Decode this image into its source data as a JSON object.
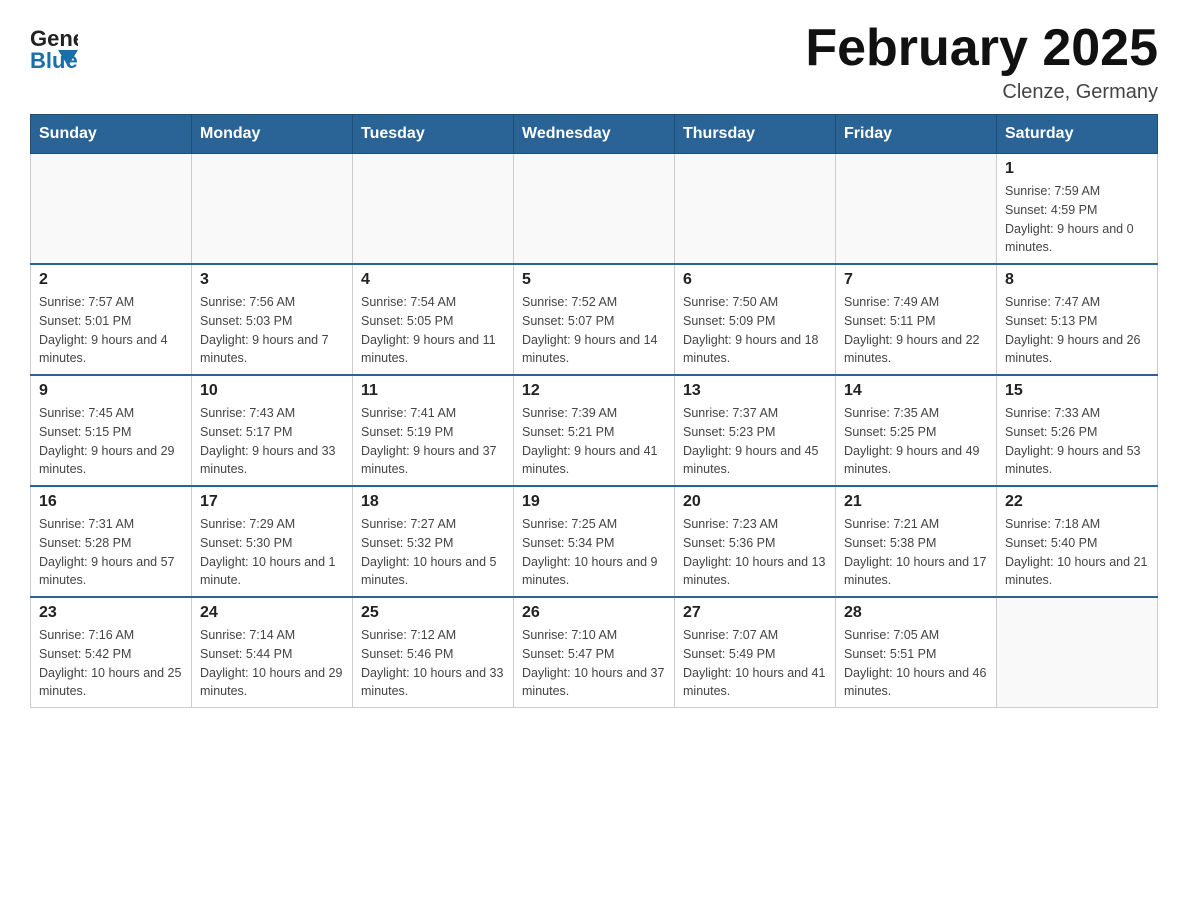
{
  "header": {
    "logo": {
      "text_general": "General",
      "text_blue": "Blue",
      "aria": "GeneralBlue logo"
    },
    "title": "February 2025",
    "subtitle": "Clenze, Germany"
  },
  "weekdays": [
    "Sunday",
    "Monday",
    "Tuesday",
    "Wednesday",
    "Thursday",
    "Friday",
    "Saturday"
  ],
  "weeks": [
    [
      {
        "day": "",
        "info": ""
      },
      {
        "day": "",
        "info": ""
      },
      {
        "day": "",
        "info": ""
      },
      {
        "day": "",
        "info": ""
      },
      {
        "day": "",
        "info": ""
      },
      {
        "day": "",
        "info": ""
      },
      {
        "day": "1",
        "info": "Sunrise: 7:59 AM\nSunset: 4:59 PM\nDaylight: 9 hours and 0 minutes."
      }
    ],
    [
      {
        "day": "2",
        "info": "Sunrise: 7:57 AM\nSunset: 5:01 PM\nDaylight: 9 hours and 4 minutes."
      },
      {
        "day": "3",
        "info": "Sunrise: 7:56 AM\nSunset: 5:03 PM\nDaylight: 9 hours and 7 minutes."
      },
      {
        "day": "4",
        "info": "Sunrise: 7:54 AM\nSunset: 5:05 PM\nDaylight: 9 hours and 11 minutes."
      },
      {
        "day": "5",
        "info": "Sunrise: 7:52 AM\nSunset: 5:07 PM\nDaylight: 9 hours and 14 minutes."
      },
      {
        "day": "6",
        "info": "Sunrise: 7:50 AM\nSunset: 5:09 PM\nDaylight: 9 hours and 18 minutes."
      },
      {
        "day": "7",
        "info": "Sunrise: 7:49 AM\nSunset: 5:11 PM\nDaylight: 9 hours and 22 minutes."
      },
      {
        "day": "8",
        "info": "Sunrise: 7:47 AM\nSunset: 5:13 PM\nDaylight: 9 hours and 26 minutes."
      }
    ],
    [
      {
        "day": "9",
        "info": "Sunrise: 7:45 AM\nSunset: 5:15 PM\nDaylight: 9 hours and 29 minutes."
      },
      {
        "day": "10",
        "info": "Sunrise: 7:43 AM\nSunset: 5:17 PM\nDaylight: 9 hours and 33 minutes."
      },
      {
        "day": "11",
        "info": "Sunrise: 7:41 AM\nSunset: 5:19 PM\nDaylight: 9 hours and 37 minutes."
      },
      {
        "day": "12",
        "info": "Sunrise: 7:39 AM\nSunset: 5:21 PM\nDaylight: 9 hours and 41 minutes."
      },
      {
        "day": "13",
        "info": "Sunrise: 7:37 AM\nSunset: 5:23 PM\nDaylight: 9 hours and 45 minutes."
      },
      {
        "day": "14",
        "info": "Sunrise: 7:35 AM\nSunset: 5:25 PM\nDaylight: 9 hours and 49 minutes."
      },
      {
        "day": "15",
        "info": "Sunrise: 7:33 AM\nSunset: 5:26 PM\nDaylight: 9 hours and 53 minutes."
      }
    ],
    [
      {
        "day": "16",
        "info": "Sunrise: 7:31 AM\nSunset: 5:28 PM\nDaylight: 9 hours and 57 minutes."
      },
      {
        "day": "17",
        "info": "Sunrise: 7:29 AM\nSunset: 5:30 PM\nDaylight: 10 hours and 1 minute."
      },
      {
        "day": "18",
        "info": "Sunrise: 7:27 AM\nSunset: 5:32 PM\nDaylight: 10 hours and 5 minutes."
      },
      {
        "day": "19",
        "info": "Sunrise: 7:25 AM\nSunset: 5:34 PM\nDaylight: 10 hours and 9 minutes."
      },
      {
        "day": "20",
        "info": "Sunrise: 7:23 AM\nSunset: 5:36 PM\nDaylight: 10 hours and 13 minutes."
      },
      {
        "day": "21",
        "info": "Sunrise: 7:21 AM\nSunset: 5:38 PM\nDaylight: 10 hours and 17 minutes."
      },
      {
        "day": "22",
        "info": "Sunrise: 7:18 AM\nSunset: 5:40 PM\nDaylight: 10 hours and 21 minutes."
      }
    ],
    [
      {
        "day": "23",
        "info": "Sunrise: 7:16 AM\nSunset: 5:42 PM\nDaylight: 10 hours and 25 minutes."
      },
      {
        "day": "24",
        "info": "Sunrise: 7:14 AM\nSunset: 5:44 PM\nDaylight: 10 hours and 29 minutes."
      },
      {
        "day": "25",
        "info": "Sunrise: 7:12 AM\nSunset: 5:46 PM\nDaylight: 10 hours and 33 minutes."
      },
      {
        "day": "26",
        "info": "Sunrise: 7:10 AM\nSunset: 5:47 PM\nDaylight: 10 hours and 37 minutes."
      },
      {
        "day": "27",
        "info": "Sunrise: 7:07 AM\nSunset: 5:49 PM\nDaylight: 10 hours and 41 minutes."
      },
      {
        "day": "28",
        "info": "Sunrise: 7:05 AM\nSunset: 5:51 PM\nDaylight: 10 hours and 46 minutes."
      },
      {
        "day": "",
        "info": ""
      }
    ]
  ]
}
